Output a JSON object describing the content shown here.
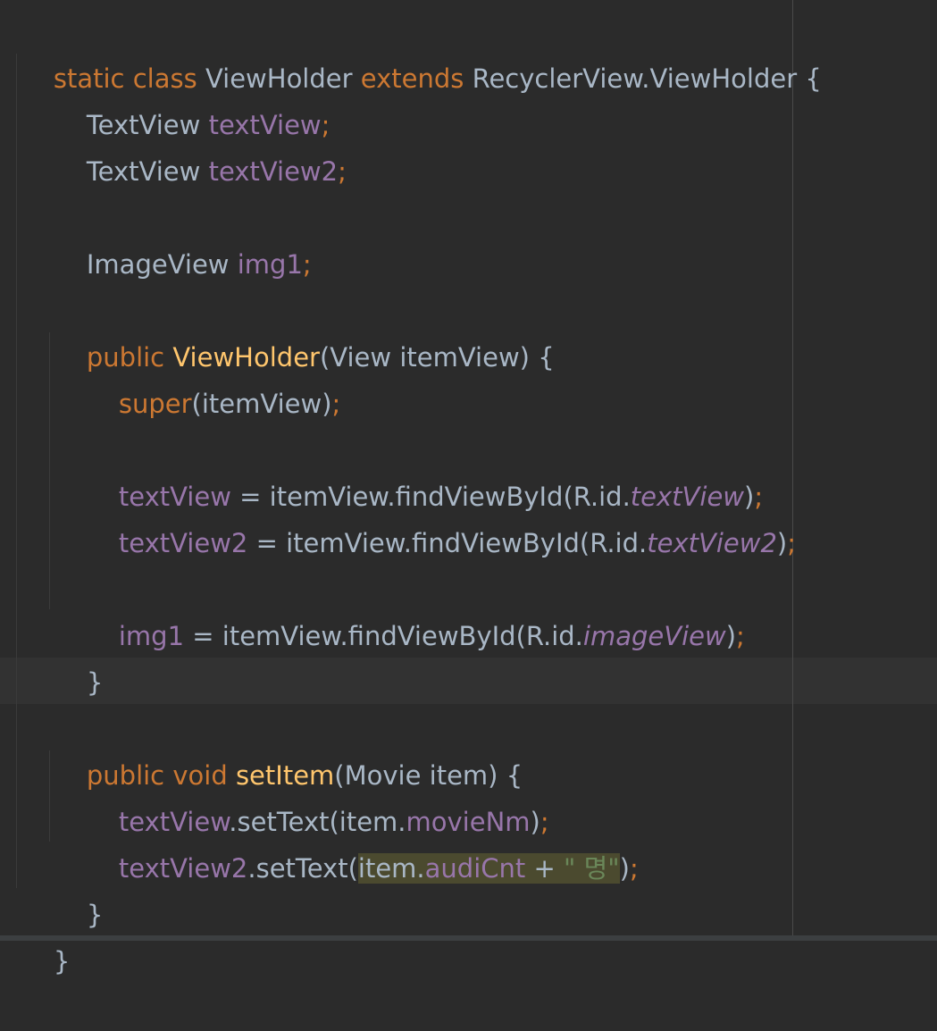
{
  "colors": {
    "background": "#2b2b2b",
    "keyword": "#cc7832",
    "field": "#9876aa",
    "method_declaration": "#ffc66d",
    "string": "#6a8759",
    "plain": "#a9b7c6",
    "current_line": "#323232",
    "selection_highlight": "#4b4a2f"
  },
  "code": {
    "line1": {
      "t1": "static class ",
      "t2": "ViewHolder ",
      "t3": "extends ",
      "t4": "RecyclerView.ViewHolder {"
    },
    "line2": {
      "t1": "TextView ",
      "t2": "textView",
      "t3": ";"
    },
    "line3": {
      "t1": "TextView ",
      "t2": "textView2",
      "t3": ";"
    },
    "line5": {
      "t1": "ImageView ",
      "t2": "img1",
      "t3": ";"
    },
    "line7": {
      "t1": "public ",
      "t2": "ViewHolder",
      "t3": "(View itemView) {"
    },
    "line8": {
      "t1": "super",
      "t2": "(itemView)",
      "t3": ";"
    },
    "line10": {
      "t1": "textView",
      "t2": " = itemView.findViewById(R.id.",
      "t3": "textView",
      "t4": ")",
      "t5": ";"
    },
    "line11": {
      "t1": "textView2",
      "t2": " = itemView.findViewById(R.id.",
      "t3": "textView2",
      "t4": ")",
      "t5": ";"
    },
    "line13": {
      "t1": "img1",
      "t2": " = itemView.findViewById(R.id.",
      "t3": "imageView",
      "t4": ")",
      "t5": ";"
    },
    "line14": {
      "t1": "}"
    },
    "line16": {
      "t1": "public ",
      "t2": "void ",
      "t3": "setItem",
      "t4": "(Movie item) {"
    },
    "line17": {
      "t1": "textView",
      "t2": ".setText(item.",
      "t3": "movieNm",
      "t4": ")",
      "t5": ";"
    },
    "line18": {
      "t1": "textView2",
      "t2": ".setText(",
      "t3": "item.",
      "t4": "audiCnt",
      "t5": " + ",
      "t6": "\" 명\"",
      "t7": ")",
      "t8": ";"
    },
    "line19": {
      "t1": "}"
    },
    "line20": {
      "t1": "}"
    }
  }
}
